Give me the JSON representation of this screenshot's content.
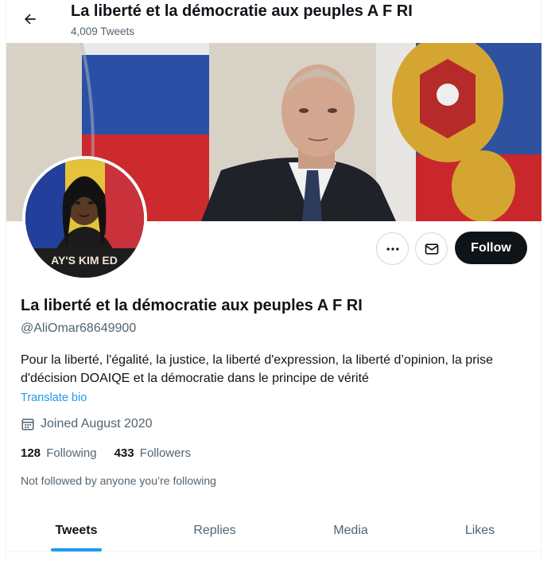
{
  "header": {
    "title": "La liberté et la démocratie aux peuples A F RI",
    "tweet_count": "4,009 Tweets"
  },
  "profile": {
    "name": "La liberté et la démocratie aux peuples A F RI",
    "handle": "@AliOmar68649900",
    "bio": "Pour la liberté, l'égalité, la justice, la liberté d'expression, la liberté d’opinion, la prise d'décision DOAIQE et la démocratie dans le principe de vérité",
    "translate_label": "Translate bio",
    "joined": "Joined August 2020",
    "following_count": "128",
    "following_label": "Following",
    "followers_count": "433",
    "followers_label": "Followers",
    "not_followed": "Not followed by anyone you’re following",
    "avatar_caption": "AY'S KIM ED"
  },
  "actions": {
    "follow_label": "Follow",
    "more_icon": "more-horizontal-icon",
    "message_icon": "envelope-icon"
  },
  "tabs": [
    {
      "label": "Tweets",
      "active": true
    },
    {
      "label": "Replies",
      "active": false
    },
    {
      "label": "Media",
      "active": false
    },
    {
      "label": "Likes",
      "active": false
    }
  ],
  "colors": {
    "accent": "#1d9bf0",
    "follow_button": "#0f1419",
    "secondary_text": "#536471"
  }
}
